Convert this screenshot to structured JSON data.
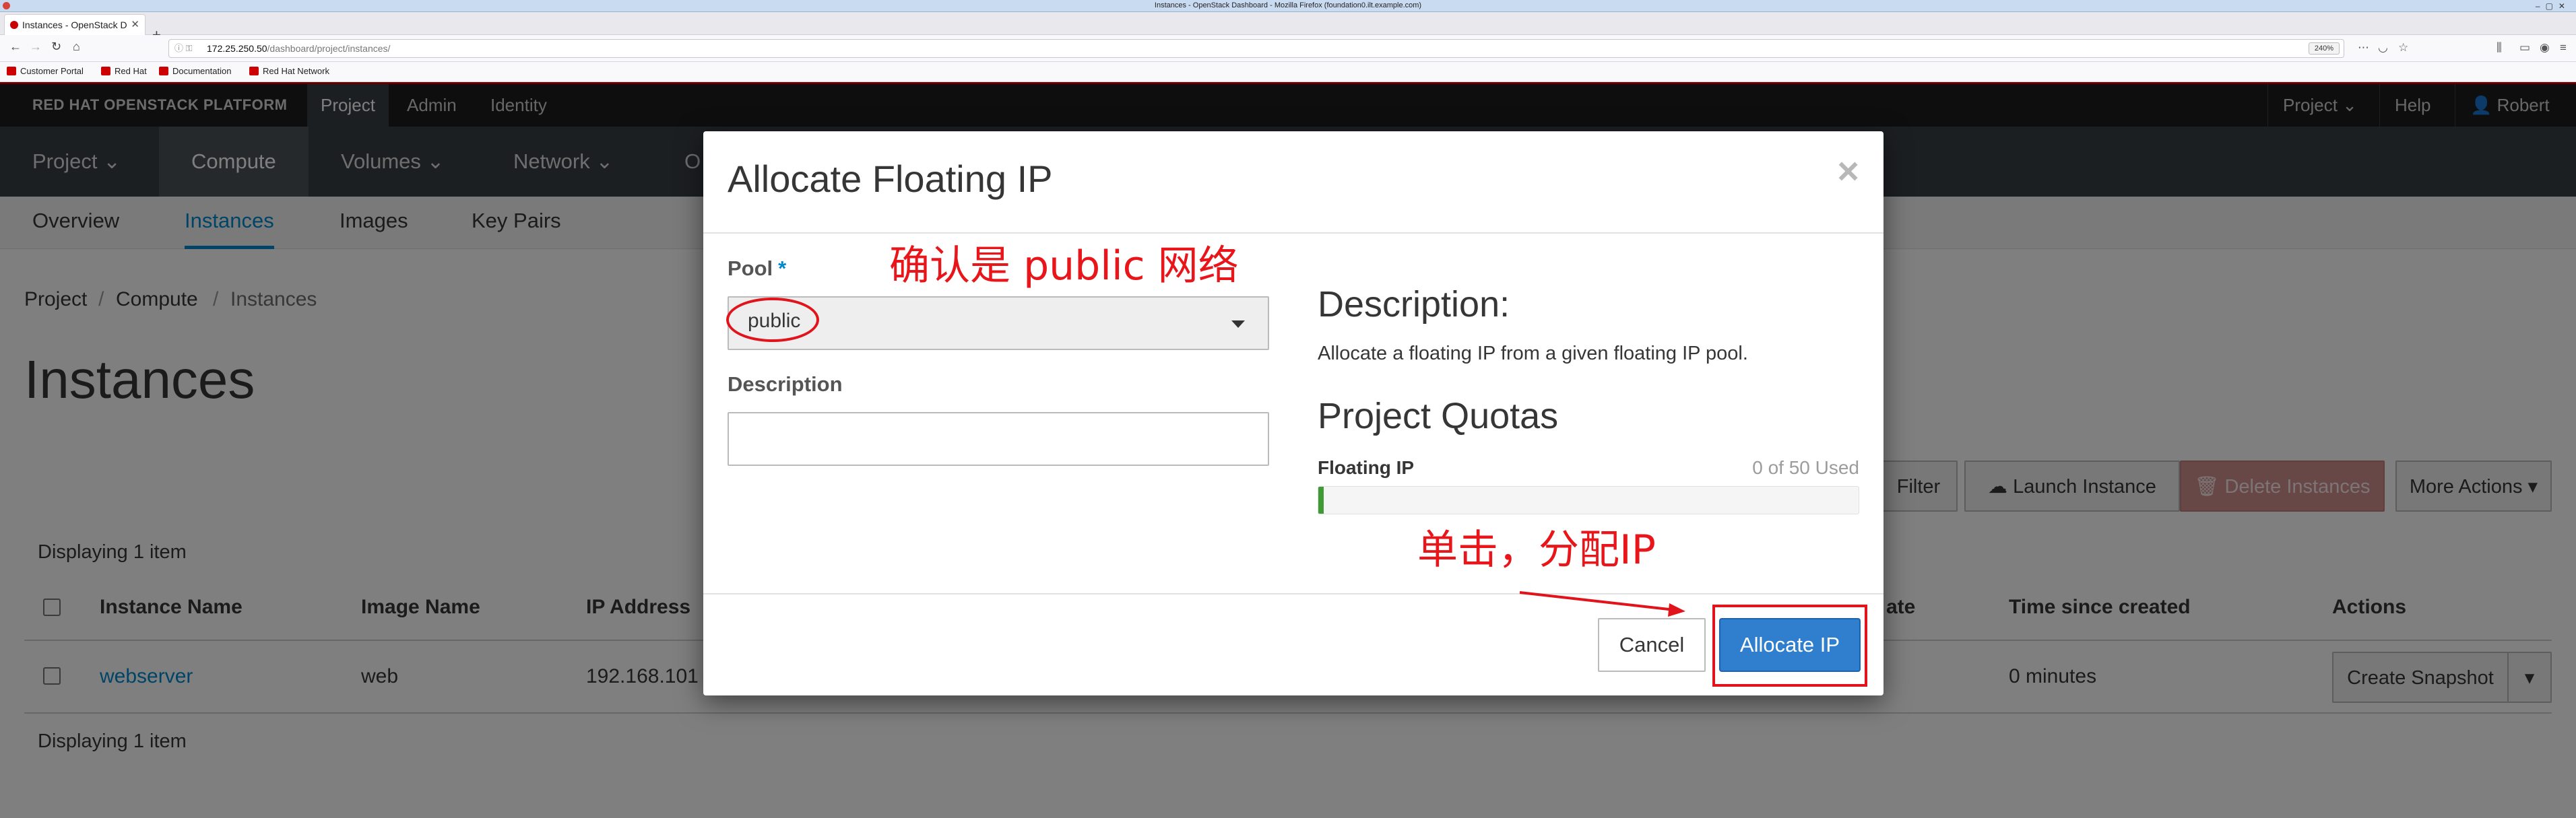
{
  "browser": {
    "window_title": "Instances - OpenStack Dashboard - Mozilla Firefox (foundation0.ilt.example.com)",
    "tab_title": "Instances - OpenStack D",
    "url_host": "172.25.250.50",
    "url_path": "/dashboard/project/instances/",
    "zoom": "240%",
    "bookmarks": [
      "Customer Portal",
      "Red Hat",
      "Documentation",
      "Red Hat Network"
    ]
  },
  "header": {
    "brand": "RED HAT OPENSTACK PLATFORM",
    "top_links": [
      "Project",
      "Admin",
      "Identity"
    ],
    "right_links": [
      "Project",
      "Help",
      "Robert"
    ]
  },
  "nav": {
    "primary": [
      "Project",
      "Compute",
      "Volumes",
      "Network",
      "O"
    ],
    "secondary": [
      "Overview",
      "Instances",
      "Images",
      "Key Pairs"
    ]
  },
  "breadcrumb": [
    "Project",
    "Compute",
    "Instances"
  ],
  "page": {
    "title": "Instances",
    "displaying": "Displaying 1 item"
  },
  "toolbar": {
    "filter": "Filter",
    "launch": "Launch Instance",
    "delete": "Delete Instances",
    "more": "More Actions"
  },
  "table": {
    "headers": [
      "Instance Name",
      "Image Name",
      "IP Address",
      "ate",
      "Time since created",
      "Actions"
    ],
    "row": {
      "name": "webserver",
      "image": "web",
      "ip": "192.168.101",
      "time": "0 minutes",
      "action": "Create Snapshot"
    }
  },
  "modal": {
    "title": "Allocate Floating IP",
    "pool_label": "Pool",
    "pool_required": "*",
    "pool_value": "public",
    "description_label": "Description",
    "description_value": "",
    "desc_heading": "Description:",
    "desc_text": "Allocate a floating IP from a given floating IP pool.",
    "quota_heading": "Project Quotas",
    "quota_label": "Floating IP",
    "quota_used_text": "0 of 50 Used",
    "quota_fill_fraction": 0.01,
    "cancel": "Cancel",
    "allocate": "Allocate IP",
    "close": "×"
  },
  "annotations": {
    "confirm_public": "确认是 public 网络",
    "click_allocate": "单击，分配IP",
    "color": "#e8161b"
  }
}
